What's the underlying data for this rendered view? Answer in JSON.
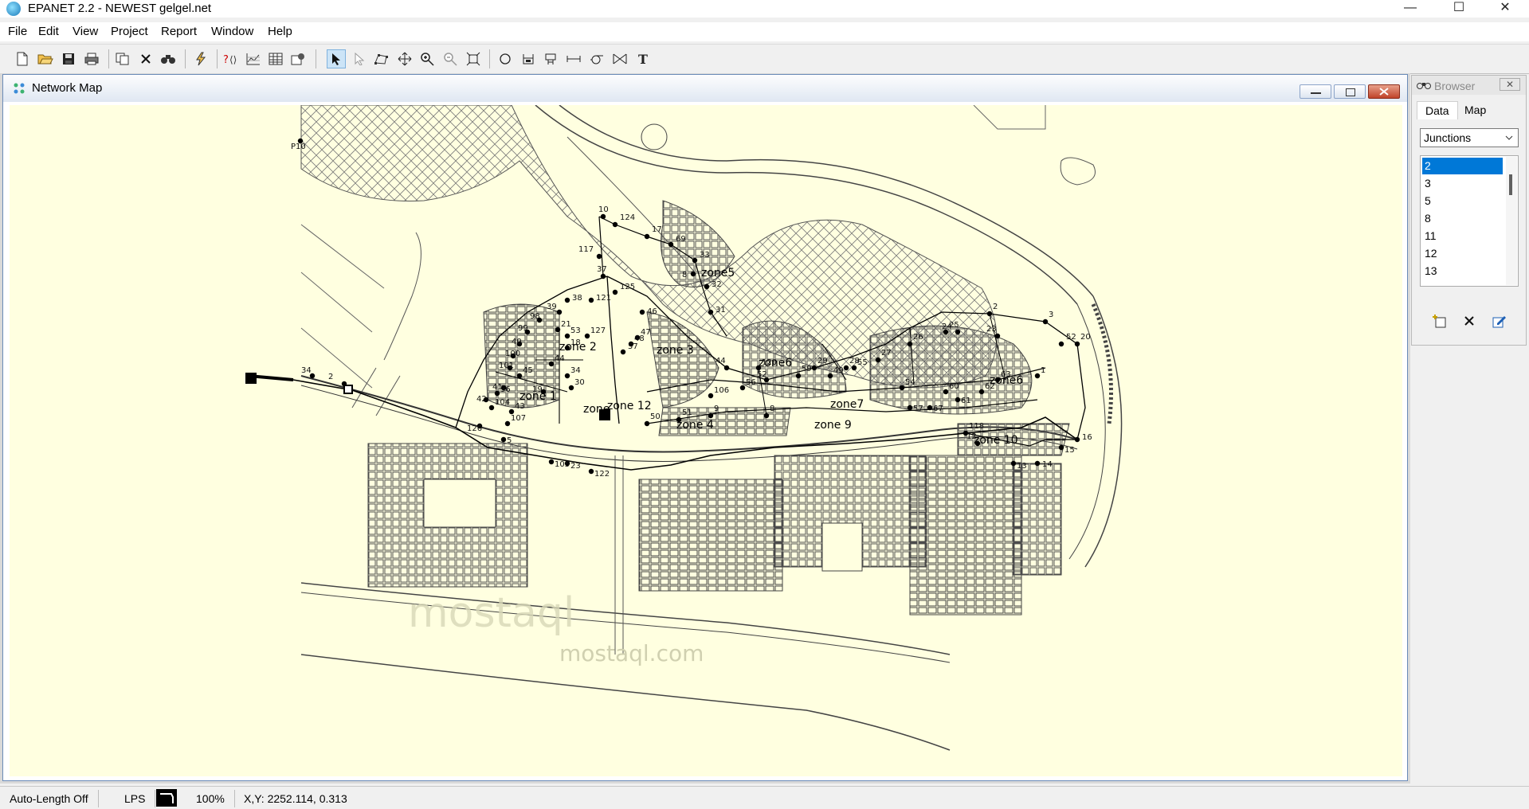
{
  "app": {
    "title": "EPANET 2.2 - NEWEST gelgel.net"
  },
  "window_controls": {
    "minimize": "—",
    "maximize": "☐",
    "close": "✕"
  },
  "menu": [
    "File",
    "Edit",
    "View",
    "Project",
    "Report",
    "Window",
    "Help"
  ],
  "toolbar_icons": [
    "new-file-icon",
    "open-file-icon",
    "save-icon",
    "print-icon",
    "copy-icon",
    "delete-icon",
    "find-icon",
    "run-icon",
    "query-icon",
    "graph-icon",
    "table-icon",
    "options-icon",
    "select-object-icon",
    "select-vertex-icon",
    "select-region-icon",
    "pan-icon",
    "zoom-in-icon",
    "zoom-out-icon",
    "full-extent-icon",
    "add-junction-icon",
    "add-reservoir-icon",
    "add-tank-icon",
    "add-pipe-icon",
    "add-pump-icon",
    "add-valve-icon",
    "add-label-icon"
  ],
  "map_window": {
    "title": "Network Map",
    "zone_labels": [
      "zone 1",
      "zone 2",
      "zone 3",
      "zone 4",
      "zone5",
      "zone6",
      "zone7",
      "zone 9",
      "zone 10",
      "zone 12",
      "zone",
      "zone6"
    ],
    "node_labels": [
      "10",
      "124",
      "17",
      "69",
      "33",
      "8",
      "32",
      "31",
      "117",
      "37",
      "125",
      "121",
      "38",
      "39",
      "98",
      "99",
      "40",
      "100",
      "101",
      "41",
      "42",
      "36",
      "21",
      "53",
      "18",
      "127",
      "57",
      "48",
      "47",
      "46",
      "44",
      "52",
      "59",
      "29",
      "28",
      "27",
      "26",
      "25",
      "24",
      "2",
      "23",
      "3",
      "52",
      "20",
      "16",
      "15",
      "14",
      "13",
      "12",
      "118",
      "50",
      "51",
      "9",
      "8",
      "122",
      "23",
      "105",
      "126",
      "5",
      "107",
      "104",
      "43",
      "45",
      "34",
      "30",
      "19",
      "44",
      "106",
      "56",
      "120",
      "49",
      "55",
      "54",
      "57",
      "67",
      "60",
      "61",
      "62",
      "63",
      "1",
      "34",
      "2",
      "P10"
    ],
    "watermark": "mostaql.com"
  },
  "browser": {
    "title": "Browser",
    "tabs": [
      "Data",
      "Map"
    ],
    "category": "Junctions",
    "items": [
      "2",
      "3",
      "5",
      "8",
      "11",
      "12",
      "13"
    ],
    "selected_index": 0
  },
  "status": {
    "auto_length": "Auto-Length Off",
    "units": "LPS",
    "zoom": "100%",
    "coords": "X,Y: 2252.114, 0.313"
  }
}
